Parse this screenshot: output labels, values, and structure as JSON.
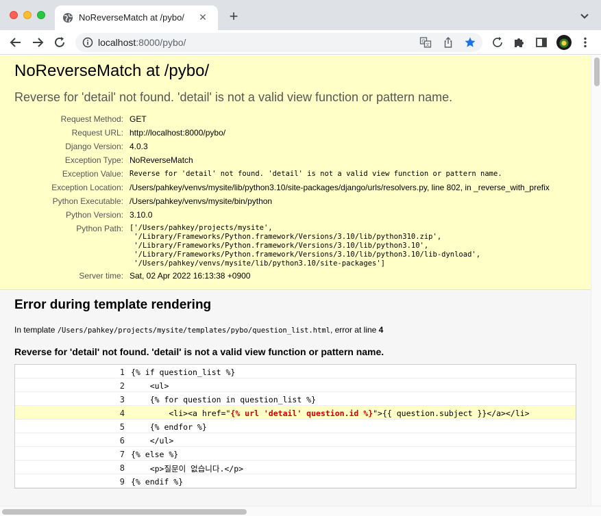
{
  "browser": {
    "tab_title": "NoReverseMatch at /pybo/",
    "url_host": "localhost",
    "url_rest": ":8000/pybo/"
  },
  "colors": {
    "summary_bg": "#ffffc8",
    "error_line_bg": "#ffffc8",
    "template_tag_highlight": "#cc0000",
    "bookmark_star": "#1a73e8"
  },
  "icons": [
    "globe-icon",
    "close-icon",
    "plus-icon",
    "chevron-down-icon",
    "back-arrow-icon",
    "forward-arrow-icon",
    "reload-icon",
    "info-icon",
    "translate-icon",
    "share-icon",
    "star-icon",
    "refresh-circle-icon",
    "puzzle-icon",
    "side-panel-icon",
    "more-vert-icon"
  ],
  "summary": {
    "title": "NoReverseMatch at /pybo/",
    "message": "Reverse for 'detail' not found. 'detail' is not a valid view function or pattern name.",
    "meta": [
      {
        "key": "Request Method:",
        "value": "GET"
      },
      {
        "key": "Request URL:",
        "value": "http://localhost:8000/pybo/"
      },
      {
        "key": "Django Version:",
        "value": "4.0.3"
      },
      {
        "key": "Exception Type:",
        "value": "NoReverseMatch"
      },
      {
        "key": "Exception Value:",
        "value": "Reverse for 'detail' not found. 'detail' is not a valid view function or pattern name."
      },
      {
        "key": "Exception Location:",
        "value": "/Users/pahkey/venvs/mysite/lib/python3.10/site-packages/django/urls/resolvers.py, line 802, in _reverse_with_prefix"
      },
      {
        "key": "Python Executable:",
        "value": "/Users/pahkey/venvs/mysite/bin/python"
      },
      {
        "key": "Python Version:",
        "value": "3.10.0"
      },
      {
        "key": "Python Path:",
        "value": "['/Users/pahkey/projects/mysite',\n '/Library/Frameworks/Python.framework/Versions/3.10/lib/python310.zip',\n '/Library/Frameworks/Python.framework/Versions/3.10/lib/python3.10',\n '/Library/Frameworks/Python.framework/Versions/3.10/lib/python3.10/lib-dynload',\n '/Users/pahkey/venvs/mysite/lib/python3.10/site-packages']"
      },
      {
        "key": "Server time:",
        "value": "Sat, 02 Apr 2022 16:13:38 +0900"
      }
    ]
  },
  "template_error": {
    "heading": "Error during template rendering",
    "in_template_prefix": "In template ",
    "template_path": "/Users/pahkey/projects/mysite/templates/pybo/question_list.html",
    "error_at_line_text": ", error at line ",
    "error_line": "4",
    "message": "Reverse for 'detail' not found. 'detail' is not a valid view function or pattern name.",
    "source_lines": [
      {
        "num": "1",
        "code": "{% if question_list %}"
      },
      {
        "num": "2",
        "code": "    <ul>"
      },
      {
        "num": "3",
        "code": "    {% for question in question_list %}"
      },
      {
        "num": "4",
        "code_before": "        <li><a href=\"",
        "code_highlight": "{% url 'detail' question.id %}",
        "code_after": "\">{{ question.subject }}</a></li>"
      },
      {
        "num": "5",
        "code": "    {% endfor %}"
      },
      {
        "num": "6",
        "code": "    </ul>"
      },
      {
        "num": "7",
        "code": "{% else %}"
      },
      {
        "num": "8",
        "code": "    <p>질문이 없습니다.</p>"
      },
      {
        "num": "9",
        "code": "{% endif %}"
      }
    ]
  }
}
